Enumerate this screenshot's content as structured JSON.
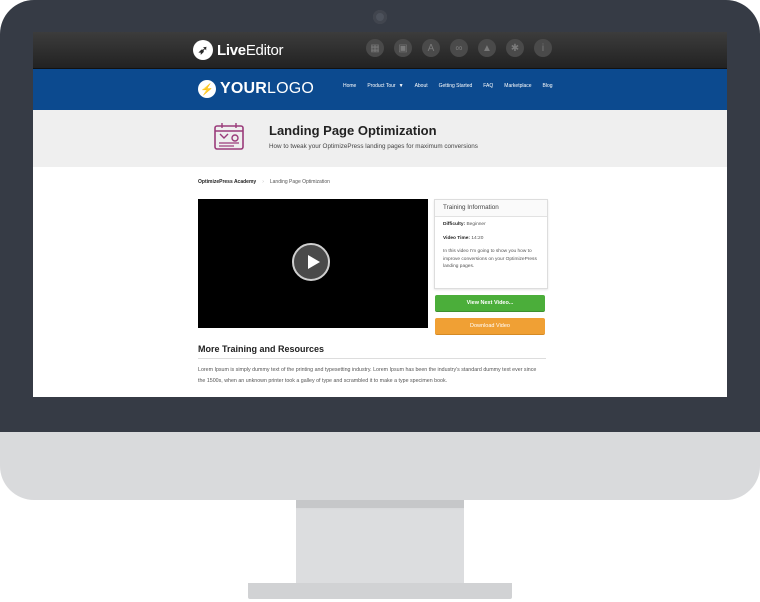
{
  "editor": {
    "brand_light": "Live",
    "brand_bold": "Editor",
    "tools": [
      "grid-icon",
      "layout-icon",
      "typography-icon",
      "link-icon",
      "lock-icon",
      "settings-icon",
      "info-icon"
    ]
  },
  "site": {
    "logo_bold": "YOUR",
    "logo_light": "LOGO",
    "menu": [
      "Home",
      "Product Tour",
      "About",
      "Getting Started",
      "FAQ",
      "Marketplace",
      "Blog"
    ]
  },
  "hero": {
    "title": "Landing Page Optimization",
    "subtitle": "How to tweak your OptimizePress landing pages for maximum conversions"
  },
  "breadcrumb": {
    "home": "OptimizePress Academy",
    "current": "Landing Page Optimization"
  },
  "training": {
    "heading": "Training Information",
    "difficulty_label": "Difficulty:",
    "difficulty_value": "Beginner",
    "time_label": "Video Time:",
    "time_value": "14:20",
    "description": "In this video I'm going to show you how to improve conversions on your OptimizePress landing pages."
  },
  "buttons": {
    "next": "View Next Video...",
    "download": "Download Video"
  },
  "more": {
    "title": "More Training and Resources",
    "text": "Lorem Ipsum is simply dummy text of the printing and typesetting industry. Lorem Ipsum has been the industry's standard dummy text ever since the 1500s, when an unknown printer took a galley of type and scrambled it to make a type specimen book."
  },
  "colors": {
    "nav_blue": "#0c4a8f",
    "next_green": "#4bae3a",
    "download_orange": "#f0a034",
    "bezel": "#363b45"
  }
}
